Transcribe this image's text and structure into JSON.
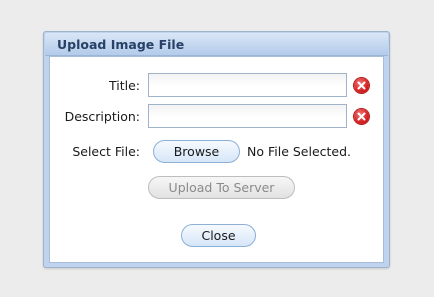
{
  "dialog": {
    "title": "Upload Image File"
  },
  "form": {
    "title_label": "Title:",
    "title_value": "",
    "description_label": "Description:",
    "description_value": "",
    "select_file_label": "Select File:",
    "browse_label": "Browse",
    "file_status": "No File Selected.",
    "upload_label": "Upload To Server",
    "close_label": "Close"
  },
  "icons": {
    "clear": "clear-icon"
  },
  "colors": {
    "titlebar": "#bfd3ee",
    "title_text": "#274266",
    "clear_icon": "#d42020",
    "button_border": "#8eb0d6"
  }
}
